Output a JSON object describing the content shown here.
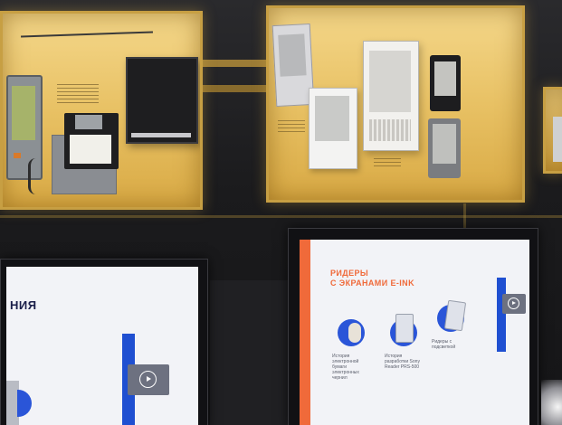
{
  "scene": {
    "colors": {
      "wall": "#1b1b1d",
      "vitrine_light": "#f4d78a",
      "vitrine_frame": "#c79f43",
      "screen_bg": "#f2f3f7",
      "accent_orange": "#f06a3a",
      "accent_blue": "#1f4fd1",
      "heading_navy": "#1b1f4a"
    }
  },
  "left_screen": {
    "heading": "НИЯ",
    "play_icon": "play-icon"
  },
  "right_screen": {
    "heading_line1": "РИДЕРЫ",
    "heading_line2": "С ЭКРАНАМИ E-INK",
    "play_icon": "play-icon",
    "topics": [
      {
        "icon": "person-icon",
        "caption": "История электронной бумаги электронных чернил"
      },
      {
        "icon": "reader-icon",
        "caption": "История разработки Sony Reader PRS-500"
      },
      {
        "icon": "reader-icon",
        "caption": "Ридеры с подсветкой"
      }
    ]
  }
}
